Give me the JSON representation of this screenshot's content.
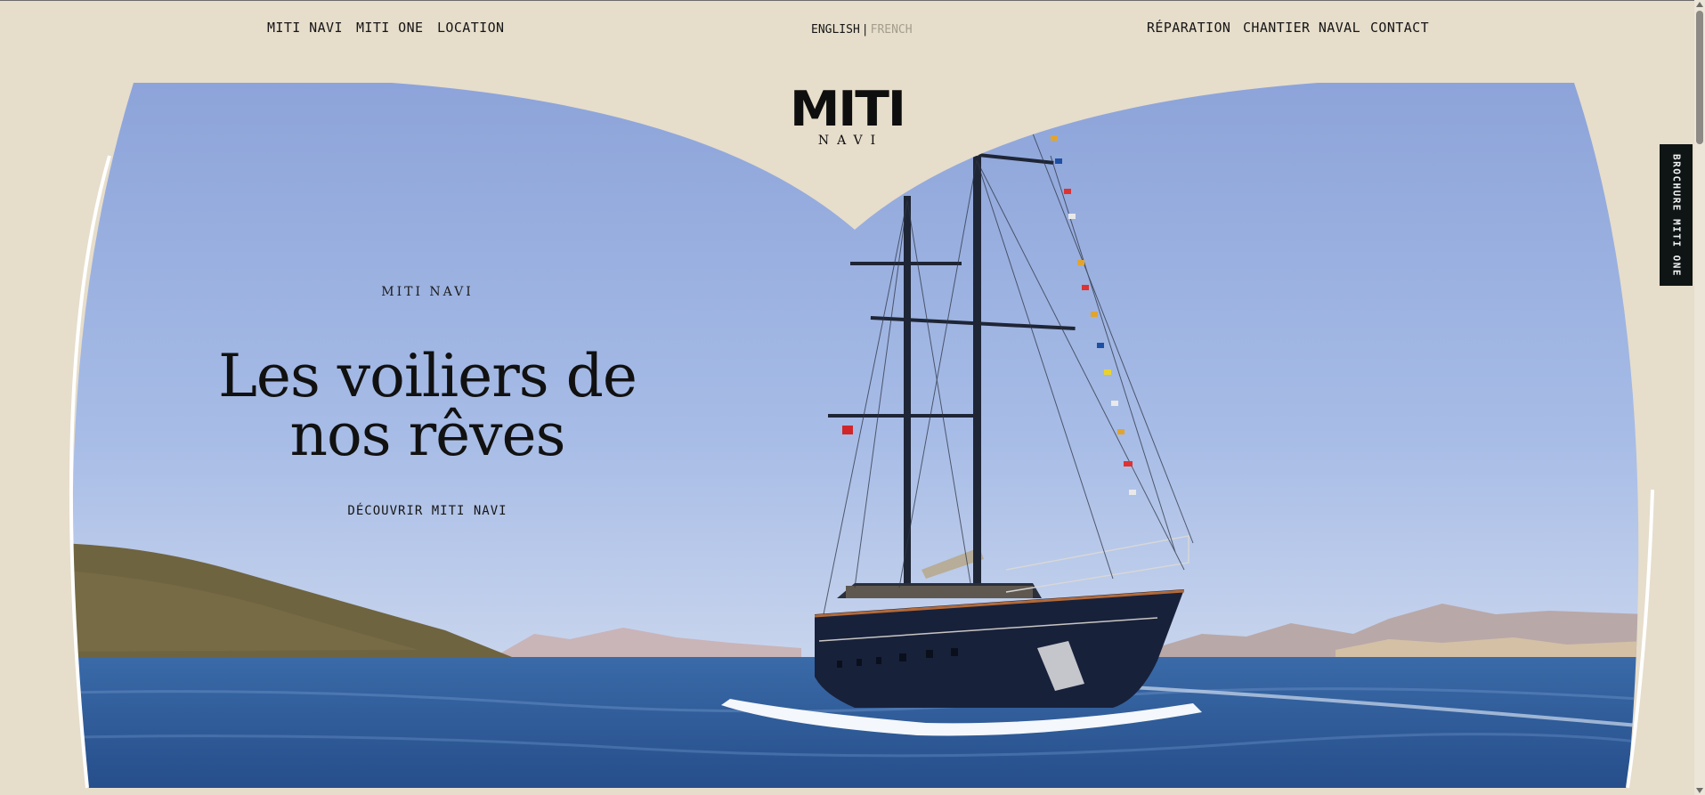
{
  "nav": {
    "left": [
      "MITI NAVI",
      "MITI ONE",
      "LOCATION"
    ],
    "right": [
      "RÉPARATION",
      "CHANTIER NAVAL",
      "CONTACT"
    ]
  },
  "language": {
    "active": "ENGLISH",
    "separator": "|",
    "inactive": "FRENCH"
  },
  "logo": {
    "mark": "MITI",
    "sub": "NAVI"
  },
  "hero": {
    "kicker": "MITI NAVI",
    "headline_line1": "Les voiliers de",
    "headline_line2": "nos rêves",
    "cta": "DÉCOUVRIR MITI NAVI",
    "boat_name": "MITI ONE"
  },
  "brochure": {
    "label": "BROCHURE MITI ONE"
  },
  "colors": {
    "background": "#e6ddcb",
    "sky_top": "#8ea6da",
    "sky_bottom": "#dbe3f3",
    "sea": "#2f5c9c",
    "hull": "#18213a",
    "tab_bg": "#0f1515"
  }
}
